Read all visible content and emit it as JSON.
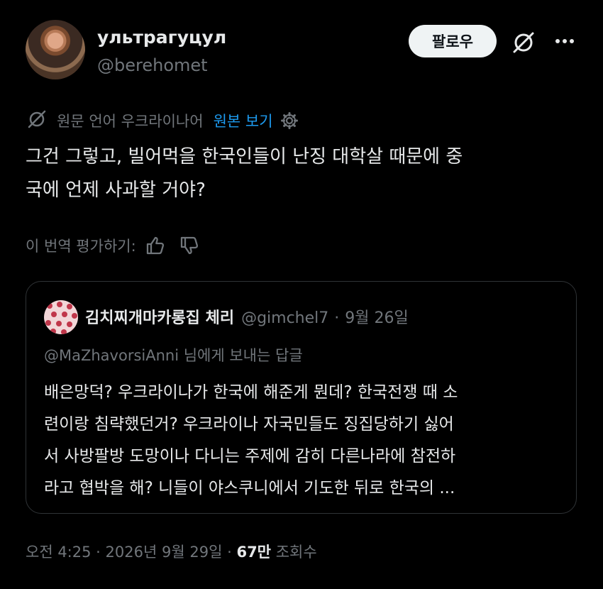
{
  "author": {
    "name": "ультрагуцул",
    "handle": "@berehomet",
    "avatar_icon": "avatar-photo"
  },
  "header": {
    "follow_label": "팔로우",
    "grok_icon": "grok-icon",
    "more_icon": "more-icon"
  },
  "translation": {
    "label": "원문 언어 우크라이나어",
    "show_original": "원본 보기"
  },
  "post": {
    "line1": "그건 그렇고, 빌어먹을 한국인들이 난징 대학살 때문에 중",
    "line2": "국에 언제 사과할 거야?"
  },
  "rate": {
    "label": "이 번역 평가하기:"
  },
  "quote": {
    "name": "김치찌개마카롱집 체리",
    "handle": "@gimchel7",
    "sep": "·",
    "date": "9월 26일",
    "reply_to": "@MaZhavorsiAnni 님에게 보내는 답글",
    "lines": [
      "배은망덕? 우크라이나가 한국에 해준게 뭔데? 한국전쟁 때 소",
      "련이랑 침략했던거? 우크라이나 자국민들도 징집당하기 싫어",
      "서 사방팔방 도망이나 다니는 주제에 감히 다른나라에 참전하",
      "라고 협박을 해? 니들이 야스쿠니에서 기도한 뒤로 한국의 ..."
    ]
  },
  "footer": {
    "time": "오전 4:25",
    "sep": "·",
    "date": "2026년 9월 29일",
    "views_count": "67만",
    "views_label": "조회수"
  },
  "colors": {
    "background": "#000000",
    "text": "#e7e9ea",
    "muted": "#71767b",
    "link": "#1d9bf0",
    "border": "#2f3336"
  }
}
